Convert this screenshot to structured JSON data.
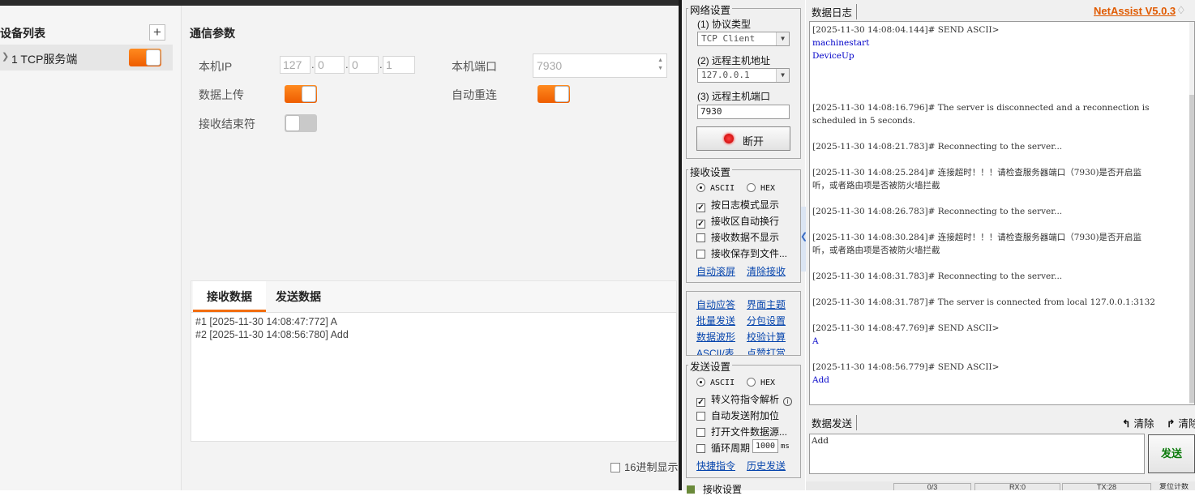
{
  "left_panel": {
    "device_list_title": "设备列表",
    "add_label": "+",
    "device_item_label": "1 TCP服务端",
    "params_title": "通信参数",
    "local_ip_label": "本机IP",
    "ip_octets": [
      "127",
      "0",
      "0",
      "1"
    ],
    "local_port_label": "本机端口",
    "local_port_value": "7930",
    "data_upload_label": "数据上传",
    "auto_reconnect_label": "自动重连",
    "recv_terminator_label": "接收结束符",
    "tab_receive": "接收数据",
    "tab_send": "发送数据",
    "received_lines": [
      "#1 [2025-11-30  14:08:47:772] A",
      "#2 [2025-11-30  14:08:56:780] Add"
    ],
    "hex_display_label": "16进制显示"
  },
  "net_panel": {
    "network_group_title": "网络设置",
    "protocol_label": "(1) 协议类型",
    "protocol_value": "TCP Client",
    "remote_host_label": "(2) 远程主机地址",
    "remote_host_value": "127.0.0.1",
    "remote_port_label": "(3) 远程主机端口",
    "remote_port_value": "7930",
    "disconnect_label": "断开",
    "recv_group_title": "接收设置",
    "recv_ascii": "ASCII",
    "recv_hex": "HEX",
    "recv_opt1": "按日志模式显示",
    "recv_opt2": "接收区自动换行",
    "recv_opt3": "接收数据不显示",
    "recv_opt4": "接收保存到文件...",
    "auto_scroll": "自动滚屏",
    "clear_recv": "清除接收",
    "link_auto_reply": "自动应答",
    "link_theme": "界面主题",
    "link_batch_send": "批量发送",
    "link_packet": "分包设置",
    "link_waveform": "数据波形",
    "link_checksum": "校验计算",
    "link_ascii_table": "ASCII/表",
    "link_checkin": "点赞打赏",
    "send_group_title": "发送设置",
    "send_ascii": "ASCII",
    "send_hex": "HEX",
    "send_opt1": "转义符指令解析",
    "send_opt2": "自动发送附加位",
    "send_opt3": "打开文件数据源...",
    "send_opt4": "循环周期",
    "cycle_value": "1000",
    "cycle_unit": "ms",
    "shortcut_cmd": "快捷指令",
    "history_send": "历史发送",
    "bottom_group_cut": "接收设置"
  },
  "log_panel": {
    "log_title": "数据日志",
    "brand": "NetAssist V5.0.3",
    "log_lines": [
      {
        "text": "[2025-11-30 14:08:04.144]# SEND ASCII>",
        "kind": "hdr"
      },
      {
        "text": "machinestart",
        "kind": "cmd"
      },
      {
        "text": "DeviceUp",
        "kind": "cmd"
      },
      {
        "text": "[2025-11-30 14:08:16.796]# The server is disconnected and a reconnection is",
        "kind": "hdr"
      },
      {
        "text": "scheduled in 5 seconds.",
        "kind": "hdr"
      },
      {
        "text": "[2025-11-30 14:08:21.783]# Reconnecting to the server...",
        "kind": "hdr"
      },
      {
        "text": "[2025-11-30 14:08:25.284]# 连接超时！！！请检查服务器端口（7930)是否开启监",
        "kind": "hdr"
      },
      {
        "text": "听，或者路由项是否被防火墙拦截",
        "kind": "hdr"
      },
      {
        "text": "[2025-11-30 14:08:26.783]# Reconnecting to the server...",
        "kind": "hdr"
      },
      {
        "text": "[2025-11-30 14:08:30.284]# 连接超时！！！请检查服务器端口（7930)是否开启监",
        "kind": "hdr"
      },
      {
        "text": "听，或者路由项是否被防火墙拦截",
        "kind": "hdr"
      },
      {
        "text": "[2025-11-30 14:08:31.783]# Reconnecting to the server...",
        "kind": "hdr"
      },
      {
        "text": "[2025-11-30 14:08:31.787]# The server is connected from local 127.0.0.1:3132",
        "kind": "hdr"
      },
      {
        "text": "[2025-11-30 14:08:47.769]# SEND ASCII>",
        "kind": "hdr"
      },
      {
        "text": "A",
        "kind": "cmd"
      },
      {
        "text": "[2025-11-30 14:08:56.779]# SEND ASCII>",
        "kind": "hdr"
      },
      {
        "text": "Add",
        "kind": "cmd"
      }
    ],
    "send_title": "数据发送",
    "clear_label": "清除",
    "clear_label2": "清除",
    "send_text": "Add",
    "send_button": "发送",
    "status_count": "0/3",
    "status_rx": "RX:0",
    "status_tx": "TX:28",
    "status_reset": "复位计数"
  }
}
